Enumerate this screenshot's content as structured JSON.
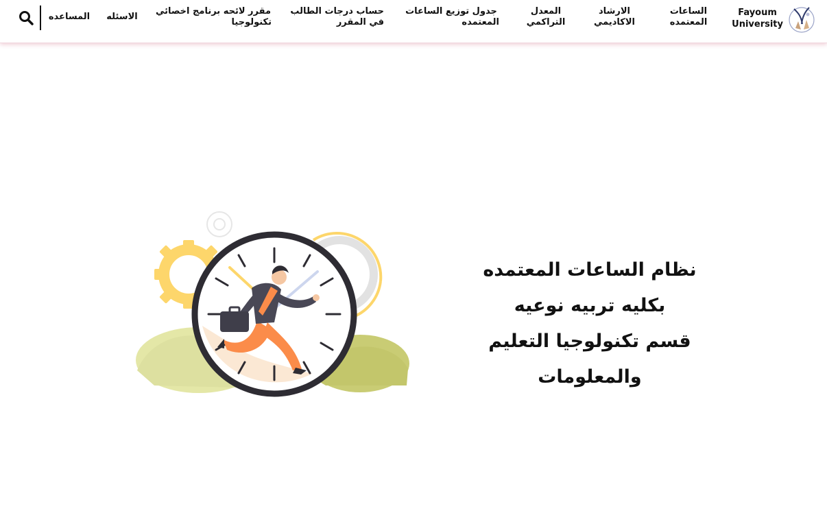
{
  "brand": {
    "line1": "Fayoum",
    "line2": "University"
  },
  "nav": {
    "items": [
      {
        "line1": "الساعات",
        "line2": "المعتمده"
      },
      {
        "line1": "الارشاد",
        "line2": "الاكاديمي"
      },
      {
        "line1": "المعدل",
        "line2": "التراكمي"
      },
      {
        "line1": "جدول توزيع الساعات",
        "line2": "المعتمده"
      },
      {
        "line1": "حساب درجات الطالب",
        "line2": "في المقرر"
      },
      {
        "line1": "مقرر لائحه برنامج اخصائي",
        "line2": "تكنولوجيا"
      },
      {
        "line1": "الاسئله",
        "line2": ""
      },
      {
        "line1": "المساعده",
        "line2": ""
      }
    ]
  },
  "hero": {
    "lines": [
      "نظام الساعات المعتمده",
      "بكليه تربيه نوعيه",
      "قسم تكنولوجيا التعليم",
      "والمعلومات"
    ]
  },
  "icons": {
    "search": "search-icon",
    "logo": "university-logo",
    "illustration": "clock-runner-illustration"
  },
  "colors": {
    "shadow": "#e8b7c4",
    "gear_yellow": "#fdd66b",
    "leaf_green": "#c9cc74",
    "runner_orange": "#fb8c4a",
    "clock_ring": "#2e2c33"
  }
}
